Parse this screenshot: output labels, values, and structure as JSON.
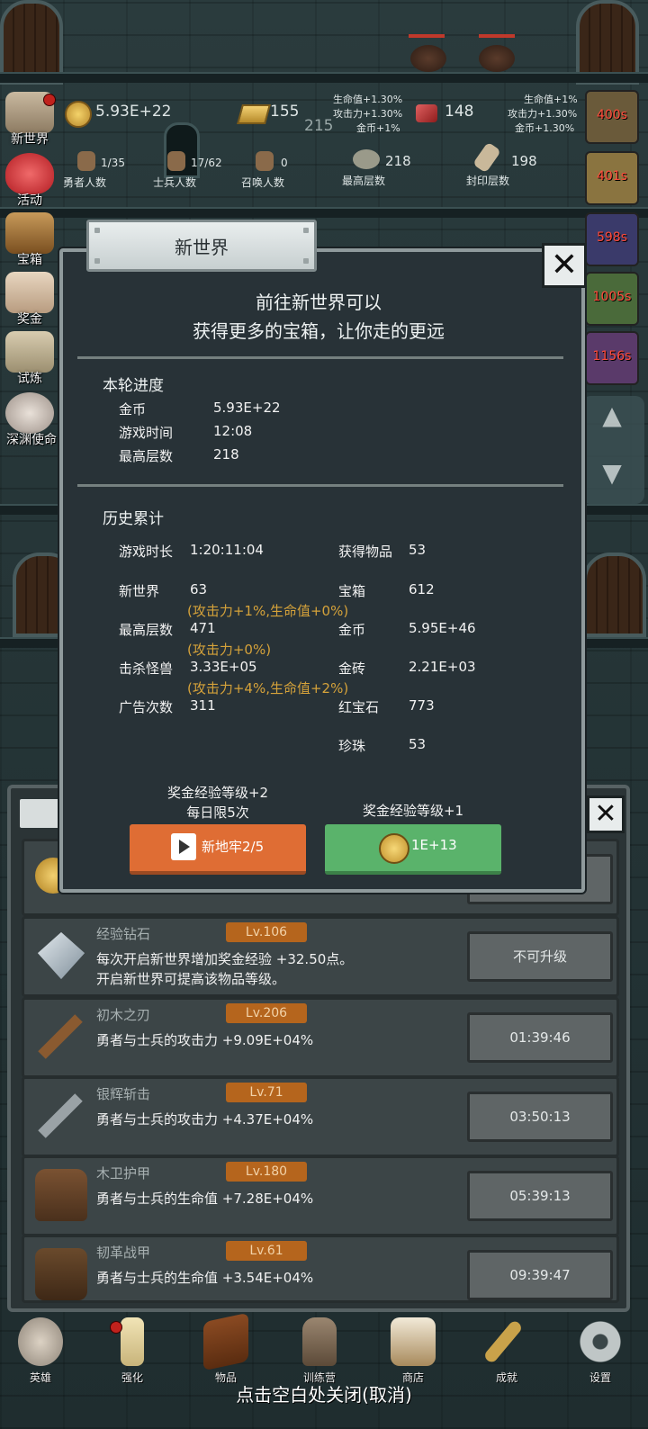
{
  "hud": {
    "gold": "5.93E+22",
    "gold_bars": "155",
    "center_value": "215",
    "rubies": "148",
    "bonus_left": [
      "生命值+1.30%",
      "攻击力+1.30%",
      "金币+1%"
    ],
    "bonus_right": [
      "生命值+1%",
      "攻击力+1.30%",
      "金币+1.30%"
    ],
    "heroes_count": "1/35",
    "heroes_label": "勇者人数",
    "soldiers_count": "17/62",
    "soldiers_label": "士兵人数",
    "summon_count": "0",
    "summon_label": "召唤人数",
    "highest_floor": "218",
    "highest_floor_label": "最高层数",
    "sealed_floor": "198",
    "sealed_floor_label": "封印层数"
  },
  "side_menu": [
    "新世界",
    "活动",
    "宝箱",
    "奖金",
    "试炼",
    "深渊使命"
  ],
  "timers": [
    "400s",
    "401s",
    "598s",
    "1005s",
    "1156s"
  ],
  "modal": {
    "title": "新世界",
    "intro_line1": "前往新世界可以",
    "intro_line2": "获得更多的宝箱，让你走的更远",
    "round_title": "本轮进度",
    "round": [
      {
        "k": "金币",
        "v": "5.93E+22"
      },
      {
        "k": "游戏时间",
        "v": "12:08"
      },
      {
        "k": "最高层数",
        "v": "218"
      }
    ],
    "history_title": "历史累计",
    "history_left": [
      {
        "k": "游戏时长",
        "v": "1:20:11:04"
      },
      {
        "k": "新世界",
        "v": "63"
      },
      {
        "k": "最高层数",
        "v": "471"
      },
      {
        "k": "击杀怪兽",
        "v": "3.33E+05"
      },
      {
        "k": "广告次数",
        "v": "311"
      }
    ],
    "history_bonus": [
      "(攻击力+1%,生命值+0%)",
      "(攻击力+0%)",
      "(攻击力+4%,生命值+2%)"
    ],
    "history_right": [
      {
        "k": "获得物品",
        "v": "53"
      },
      {
        "k": "宝箱",
        "v": "612"
      },
      {
        "k": "金币",
        "v": "5.95E+46"
      },
      {
        "k": "金砖",
        "v": "2.21E+03"
      },
      {
        "k": "红宝石",
        "v": "773"
      },
      {
        "k": "珍珠",
        "v": "53"
      }
    ],
    "left_note_line1": "奖金经验等级+2",
    "left_note_line2": "每日限5次",
    "right_note": "奖金经验等级+1",
    "ad_button": "新地牢2/5",
    "coin_button": "1E+13"
  },
  "list": [
    {
      "name": "经验钻石",
      "level": "Lv.106",
      "desc1": "每次开启新世界增加奖金经验 +32.50点。",
      "desc2": "开启新世界可提高该物品等级。",
      "button": "不可升级"
    },
    {
      "name": "初木之刃",
      "level": "Lv.206",
      "desc1": "勇者与士兵的攻击力 +9.09E+04%",
      "button": "01:39:46"
    },
    {
      "name": "银辉斩击",
      "level": "Lv.71",
      "desc1": "勇者与士兵的攻击力 +4.37E+04%",
      "button": "03:50:13"
    },
    {
      "name": "木卫护甲",
      "level": "Lv.180",
      "desc1": "勇者与士兵的生命值 +7.28E+04%",
      "button": "05:39:13"
    },
    {
      "name": "韧革战甲",
      "level": "Lv.61",
      "desc1": "勇者与士兵的生命值 +3.54E+04%",
      "button": "09:39:47"
    }
  ],
  "bottom_nav": [
    "英雄",
    "强化",
    "物品",
    "训练营",
    "商店",
    "成就",
    "设置"
  ],
  "bottom_hint": "点击空白处关闭(取消)"
}
